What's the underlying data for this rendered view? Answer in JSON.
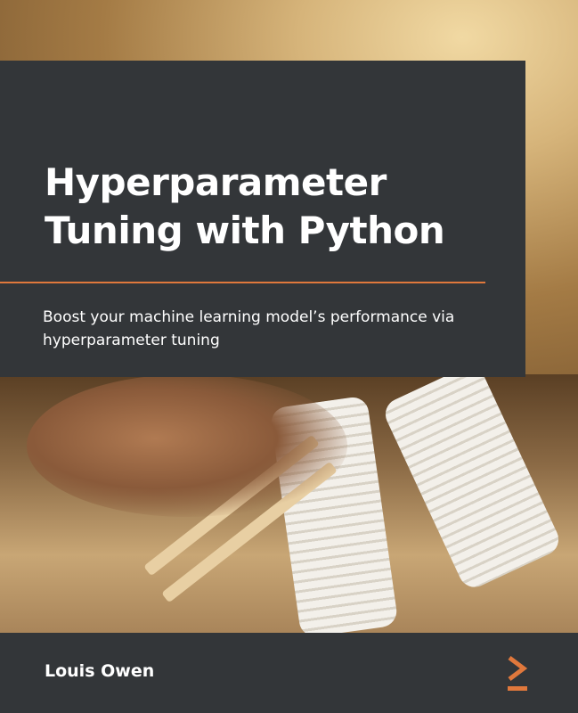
{
  "book": {
    "title": "Hyperparameter Tuning with Python",
    "subtitle": "Boost your machine learning model’s performance via hyperparameter tuning",
    "author": "Louis Owen"
  },
  "colors": {
    "panel": "#333639",
    "accent": "#e0783c",
    "text": "#ffffff"
  },
  "icons": {
    "publisher_logo": "chevron-right-underscore-icon"
  }
}
